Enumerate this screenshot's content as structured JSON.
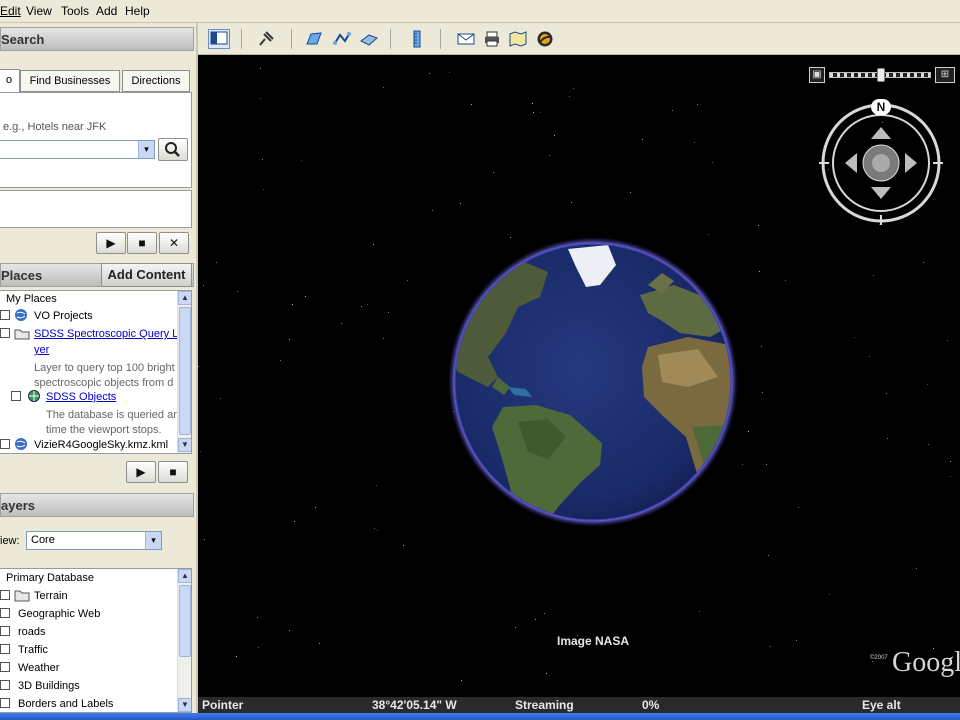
{
  "menu": {
    "items": [
      "Edit",
      "View",
      "Tools",
      "Add",
      "Help"
    ]
  },
  "search": {
    "header": "Search",
    "tabs": [
      "o",
      "Find Businesses",
      "Directions"
    ],
    "hint": "e.g., Hotels near JFK",
    "query_value": ""
  },
  "tour_controls": {
    "play": "▶",
    "stop": "■",
    "close": "✕"
  },
  "places": {
    "header": "Places",
    "add_content_label": "Add Content",
    "items": [
      {
        "label": "My Places"
      },
      {
        "label": "VO Projects"
      },
      {
        "label_line1": "SDSS Spectroscopic Query L",
        "label_line2": "yer",
        "desc_line1": "Layer to query top 100 bright",
        "desc_line2": "spectroscopic objects from d"
      },
      {
        "label": "SDSS Objects",
        "desc_line1": "The database is queried ar",
        "desc_line2": "time the viewport stops."
      },
      {
        "label": "VizieR4GoogleSky.kmz.kml"
      }
    ],
    "play": "▶",
    "stop": "■"
  },
  "layers": {
    "header": "ayers",
    "view_label": "iew:",
    "view_value": "Core",
    "items": [
      "Primary Database",
      "Terrain",
      "Geographic Web",
      "roads",
      "Traffic",
      "Weather",
      "3D Buildings",
      "Borders and Labels"
    ]
  },
  "navigation": {
    "north_label": "N"
  },
  "map": {
    "credit": "Image NASA",
    "copyright": "©2007",
    "logo_text": "Googl"
  },
  "status": {
    "pointer_label": "Pointer",
    "coord": "38°42'05.14\" W",
    "streaming_label": "Streaming",
    "streaming_pct": "0%",
    "eye_alt_label": "Eye alt"
  },
  "colors": {
    "panel_bg": "#ece9d8",
    "space": "#000000",
    "ocean": "#1f2f6e",
    "atmosphere": "#7a6cff",
    "link": "#0000cc"
  }
}
